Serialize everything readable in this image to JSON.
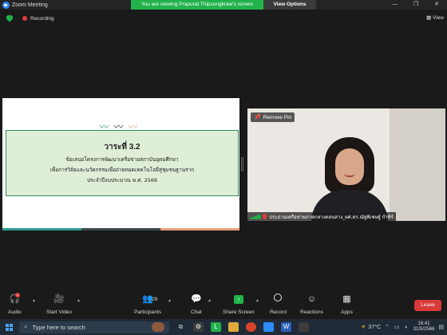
{
  "window": {
    "title": "Zoom Meeting",
    "share_banner": "You are viewing Prapurat Thipsungkraw's screen",
    "view_options": "View Options",
    "controls": [
      "—",
      "❐",
      "✕"
    ]
  },
  "status": {
    "recording_label": "Recording"
  },
  "slide": {
    "heading": "วาระที่ 3.2",
    "lines": [
      "ข้อเสนอโครงการพัฒนาเครือข่ายสถาบันอุดมศึกษา",
      "เพื่อการวิจัยและนวัตกรรมเพื่อถ่ายทอดเทคโนโลยีสู่ชุมชนฐานราก",
      "ประจำปีงบประมาณ พ.ศ. 2566"
    ]
  },
  "video": {
    "remove_pin_label": "Remove Pin",
    "participant_name": "ประธานเครือข่ายภาคกลางตอนล่าง_ผศ.ดร.ณัฐพิเชษฐ์ กำพีร์"
  },
  "toolbar": {
    "audio": "Audio",
    "audio_badge": "1",
    "start_video": "Start Video",
    "participants": "Participants",
    "participants_count": "29",
    "chat": "Chat",
    "share_screen": "Share Screen",
    "record": "Record",
    "reactions": "Reactions",
    "apps": "Apps",
    "leave": "Leave"
  },
  "taskbar": {
    "search_placeholder": "Type here to search",
    "temperature": "37°C",
    "time": "16:41",
    "date": "31/5/2566"
  },
  "colors": {
    "share_green": "#21b24b",
    "leave_red": "#d83a3a",
    "slide_box_bg": "#dfeed7"
  }
}
